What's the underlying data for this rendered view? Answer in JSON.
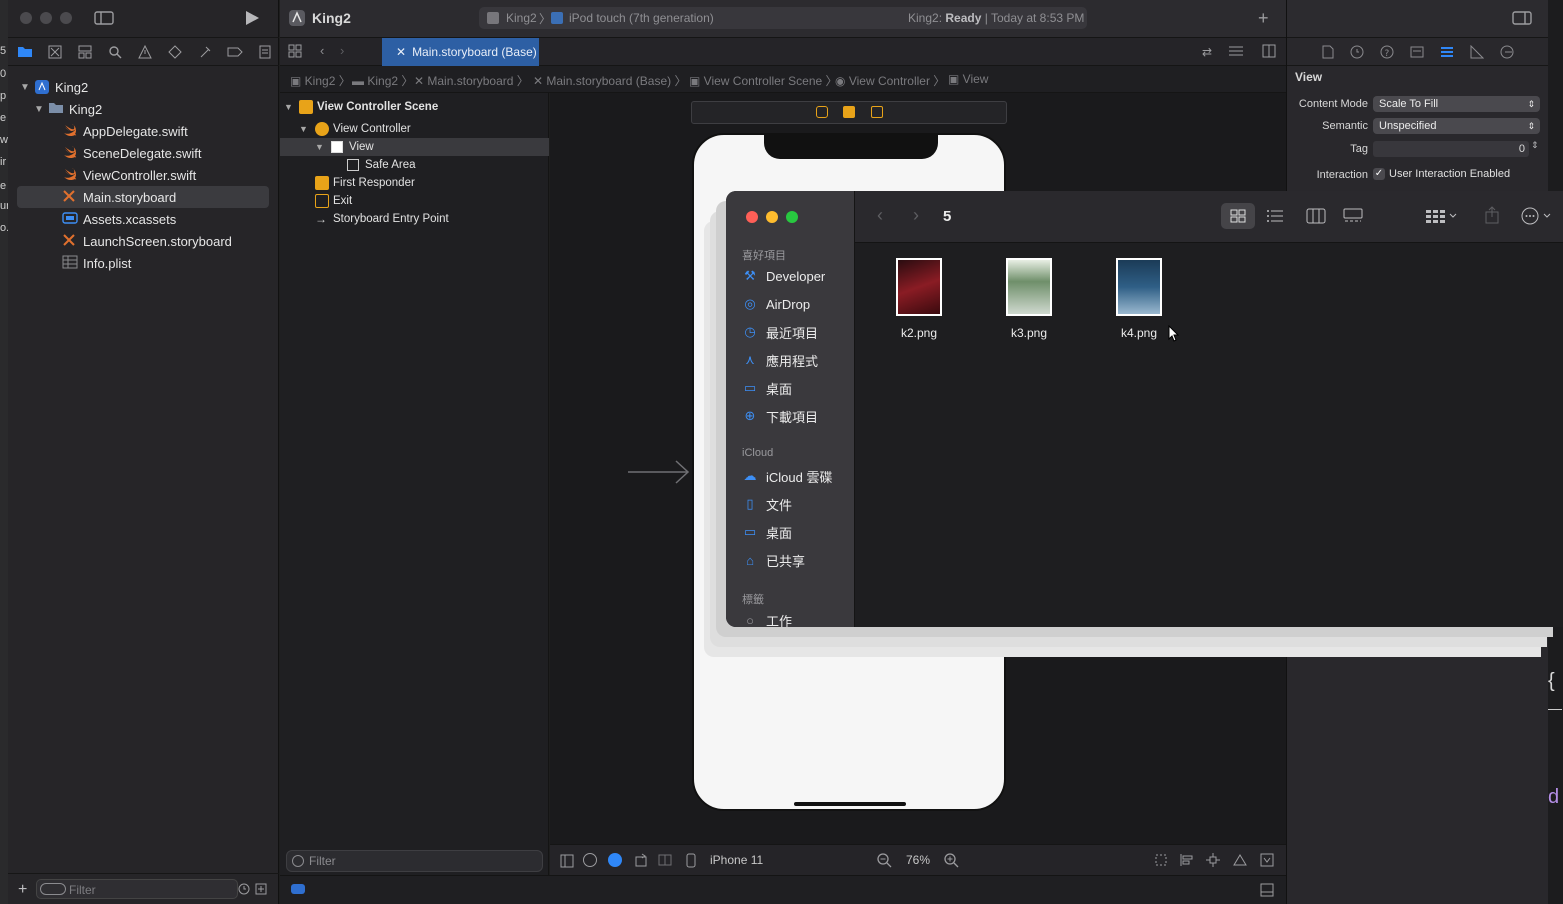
{
  "xcode": {
    "project_name": "King2",
    "scheme": "King2",
    "device": "iPod touch (7th generation)",
    "status_project": "King2:",
    "status_state": "Ready",
    "status_time": "| Today at 8:53 PM",
    "tab_label": "Main.storyboard (Base)",
    "navigator": {
      "items": [
        {
          "label": "King2",
          "kind": "project"
        },
        {
          "label": "King2",
          "kind": "folder"
        },
        {
          "label": "AppDelegate.swift",
          "kind": "swift"
        },
        {
          "label": "SceneDelegate.swift",
          "kind": "swift"
        },
        {
          "label": "ViewController.swift",
          "kind": "swift"
        },
        {
          "label": "Main.storyboard",
          "kind": "storyboard"
        },
        {
          "label": "Assets.xcassets",
          "kind": "assets"
        },
        {
          "label": "LaunchScreen.storyboard",
          "kind": "storyboard"
        },
        {
          "label": "Info.plist",
          "kind": "plist"
        }
      ],
      "filter_placeholder": "Filter"
    },
    "jumpbar": [
      "King2",
      "King2",
      "Main.storyboard",
      "Main.storyboard (Base)",
      "View Controller Scene",
      "View Controller",
      "View"
    ],
    "outline": {
      "items": [
        {
          "label": "View Controller Scene"
        },
        {
          "label": "View Controller"
        },
        {
          "label": "View"
        },
        {
          "label": "Safe Area"
        },
        {
          "label": "First Responder"
        },
        {
          "label": "Exit"
        },
        {
          "label": "Storyboard Entry Point"
        }
      ],
      "filter_placeholder": "Filter"
    },
    "canvas_bottom": {
      "device": "iPhone 11",
      "zoom": "76%"
    },
    "inspector": {
      "section": "View",
      "content_mode_label": "Content Mode",
      "content_mode_value": "Scale To Fill",
      "semantic_label": "Semantic",
      "semantic_value": "Unspecified",
      "tag_label": "Tag",
      "tag_value": "0",
      "interaction_label": "Interaction",
      "interaction_value": "User Interaction Enabled"
    },
    "edge_glyphs": [
      "5",
      "0",
      "p",
      "e",
      "w",
      "ir",
      "e",
      "ur",
      "o."
    ],
    "right_glyphs": [
      "{",
      "—",
      "d"
    ]
  },
  "finder": {
    "folder_title": "5",
    "sections": {
      "favorites": "喜好項目",
      "icloud": "iCloud",
      "tags": "標籤"
    },
    "favorites": [
      {
        "label": "Developer",
        "icon": "hammer-icon"
      },
      {
        "label": "AirDrop",
        "icon": "airdrop-icon"
      },
      {
        "label": "最近項目",
        "icon": "clock-icon"
      },
      {
        "label": "應用程式",
        "icon": "apps-icon"
      },
      {
        "label": "桌面",
        "icon": "desktop-icon"
      },
      {
        "label": "下載項目",
        "icon": "download-icon"
      }
    ],
    "icloud_items": [
      {
        "label": "iCloud 雲碟",
        "icon": "cloud-icon"
      },
      {
        "label": "文件",
        "icon": "document-icon"
      },
      {
        "label": "桌面",
        "icon": "desktop-icon"
      },
      {
        "label": "已共享",
        "icon": "shared-folder-icon"
      }
    ],
    "tag_items": [
      {
        "label": "工作",
        "icon": "tag-circle-icon"
      }
    ],
    "files": [
      {
        "name": "k2.png",
        "color": "#8a1c24"
      },
      {
        "name": "k3.png",
        "color": "#6f8f6a"
      },
      {
        "name": "k4.png",
        "color": "#2f5f86"
      }
    ]
  },
  "colors": {
    "accent": "#2f87f7",
    "tab_selected": "#2d5fa4"
  }
}
